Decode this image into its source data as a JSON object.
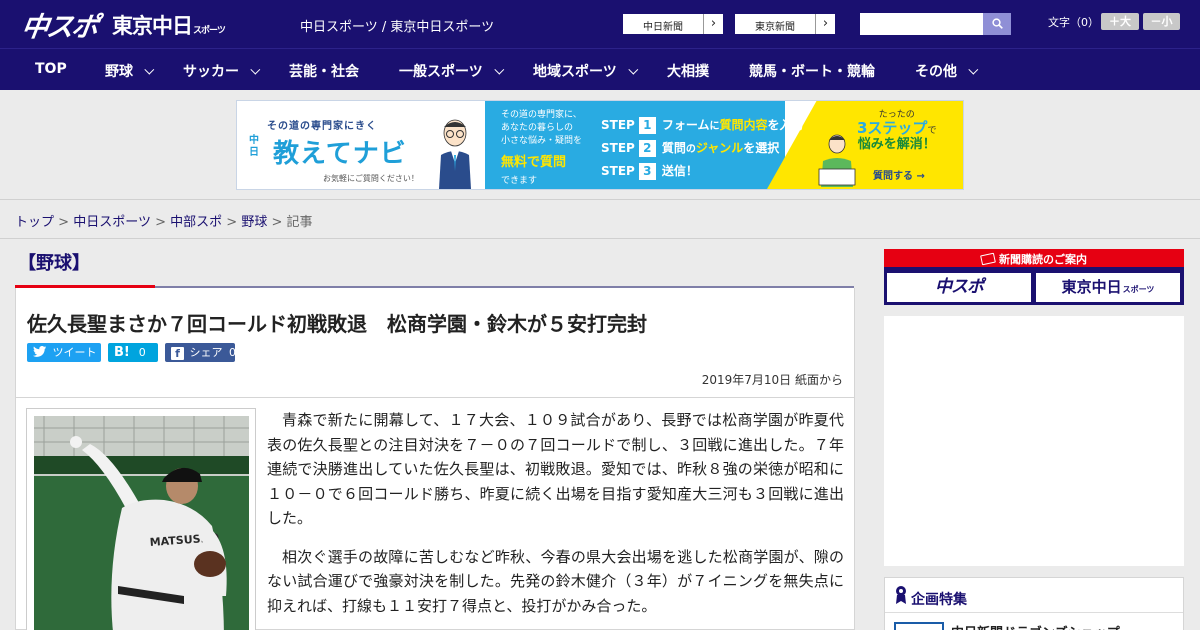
{
  "header": {
    "logo_chusupo": "中スポ",
    "logo_tokyo": "東京中日",
    "logo_tokyo_sub": "スポーツ",
    "site_links": "中日スポーツ / 東京中日スポーツ",
    "paper_links": [
      {
        "label": "中日新聞"
      },
      {
        "label": "東京新聞"
      }
    ],
    "search_placeholder": "",
    "font_size_label": "文字（0）",
    "font_up": "＋大",
    "font_down": "－小",
    "colors": {
      "primary": "#1a1070",
      "accent": "#e60012"
    }
  },
  "nav": {
    "items": [
      {
        "label": "TOP",
        "dropdown": false
      },
      {
        "label": "野球",
        "dropdown": true
      },
      {
        "label": "サッカー",
        "dropdown": true
      },
      {
        "label": "芸能・社会",
        "dropdown": false
      },
      {
        "label": "一般スポーツ",
        "dropdown": true
      },
      {
        "label": "地域スポーツ",
        "dropdown": true
      },
      {
        "label": "大相撲",
        "dropdown": false
      },
      {
        "label": "競馬・ボート・競輪",
        "dropdown": false
      },
      {
        "label": "その他",
        "dropdown": true
      }
    ]
  },
  "banner": {
    "tagline": "その道の専門家にきく",
    "chunichi": "中日",
    "title": "教えてナビ",
    "note": "お気軽にご質問ください！",
    "intro_lines": [
      "その道の専門家に、",
      "あなたの暮らしの",
      "小さな悩み・疑問を"
    ],
    "free": "無料で質問",
    "dekimasu": "できます",
    "steps": [
      {
        "step": "STEP",
        "num": "1",
        "pre": "フォーム",
        "mid": "に",
        "hl": "質問内容",
        "post": "を入力"
      },
      {
        "step": "STEP",
        "num": "2",
        "pre": "質問",
        "mid": "の",
        "hl": "ジャンル",
        "post": "を選択"
      },
      {
        "step": "STEP",
        "num": "3",
        "pre": "送信！",
        "mid": "",
        "hl": "",
        "post": ""
      }
    ],
    "easy_top": "たったの",
    "easy_big": "3ステップ",
    "easy_de": "で",
    "easy_solve": "悩みを解消！",
    "ask": "質問する →"
  },
  "breadcrumb": {
    "items": [
      "トップ",
      "中日スポーツ",
      "中部スポ",
      "野球"
    ],
    "current": "記事",
    "separator": ">"
  },
  "article": {
    "section": "【野球】",
    "headline": "佐久長聖まさか７回コールド初戦敗退　松商学園・鈴木が５安打完封",
    "share": {
      "tweet": "ツイート",
      "hatena_label": "B!",
      "hatena_count": "0",
      "facebook_label": "シェア",
      "facebook_count": "0"
    },
    "dateline": "2019年7月10日 紙面から",
    "paragraphs": [
      "青森で新たに開幕して、１７大会、１０９試合があり、長野では松商学園が昨夏代表の佐久長聖との注目対決を７－０の７回コールドで制し、３回戦に進出した。７年連続で決勝進出していた佐久長聖は、初戦敗退。愛知では、昨秋８強の栄徳が昭和に１０－０で６回コールド勝ち、昨夏に続く出場を目指す愛知産大三河も３回戦に進出した。",
      "相次ぐ選手の故障に苦しむなど昨秋、今春の県大会出場を逃した松商学園が、隙のない試合運びで強豪対決を制した。先発の鈴木健介（３年）が７イニングを無失点に抑えれば、打線も１１安打７得点と、投打がかみ合った。"
    ],
    "photo_jersey": "MATSUSHO"
  },
  "sidebar": {
    "subscribe_label": "新聞購読のご案内",
    "sub_logos": [
      "中スポ",
      "東京中日"
    ],
    "sub_logo_small": "スポーツ",
    "feature_title": "企画特集",
    "feature_item": "中日新聞ドラゴンズショップ"
  }
}
